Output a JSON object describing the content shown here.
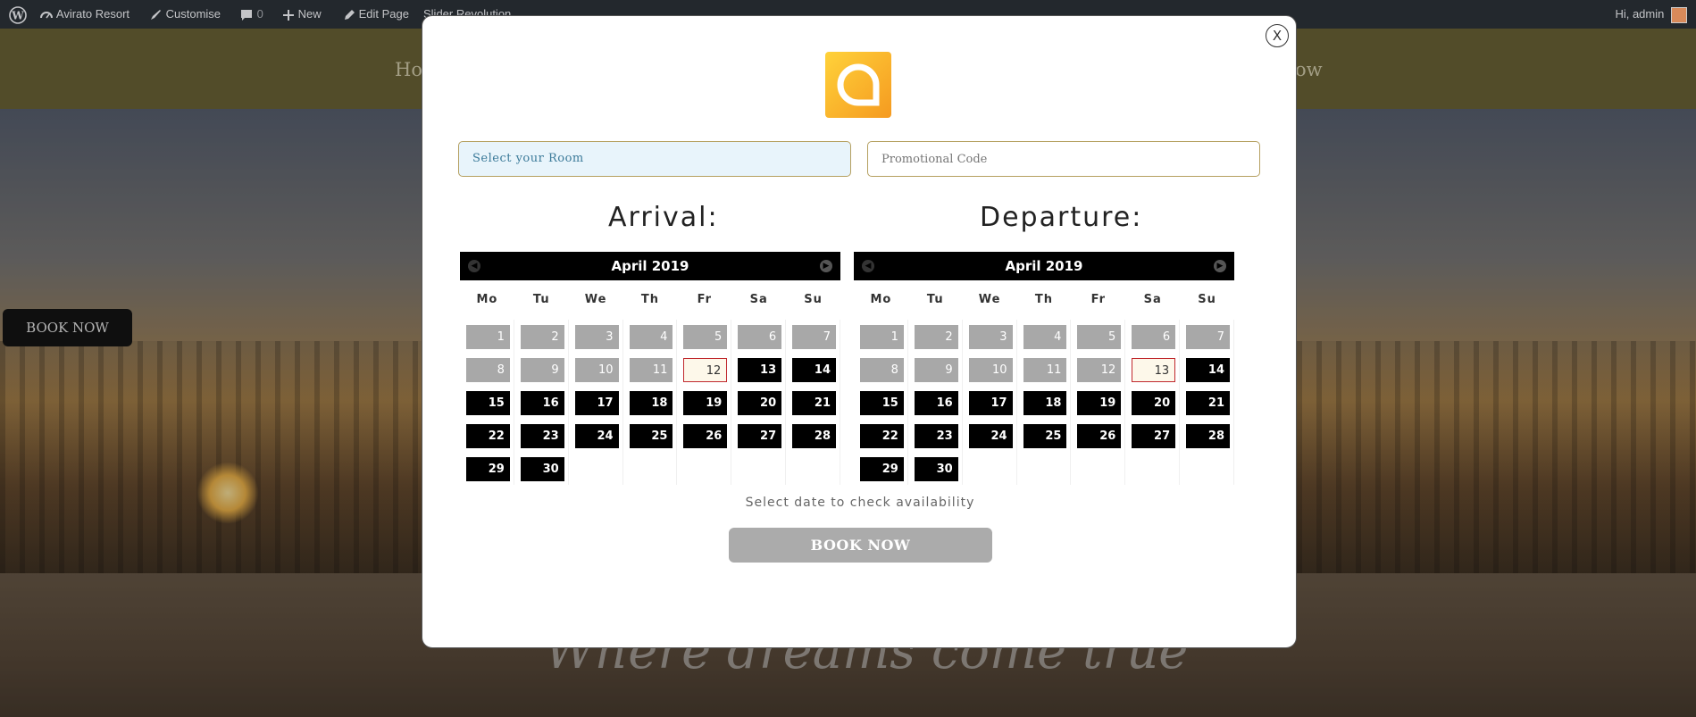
{
  "admin_bar": {
    "site_name": "Avirato Resort",
    "customise": "Customise",
    "comments_count": "0",
    "new": "New",
    "edit_page": "Edit Page",
    "slider": "Slider Revolution",
    "greeting": "Hi, admin"
  },
  "site": {
    "nav_left": "Ho",
    "nav_right": "ow",
    "side_book_label": "BOOK NOW",
    "hero_text": "Where dreams come true"
  },
  "modal": {
    "close_label": "X",
    "room_select": "Select your Room",
    "promo_placeholder": "Promotional Code",
    "arrival_title": "Arrival:",
    "departure_title": "Departure:",
    "hint": "Select date to check availability",
    "book_label": "BOOK NOW"
  },
  "calendars": [
    {
      "month": "April 2019",
      "weekdays": [
        "Mo",
        "Tu",
        "We",
        "Th",
        "Fr",
        "Sa",
        "Su"
      ],
      "last_past_day": 11,
      "selected_day": 12,
      "days_in_month": 30,
      "first_weekday_index": 0
    },
    {
      "month": "April 2019",
      "weekdays": [
        "Mo",
        "Tu",
        "We",
        "Th",
        "Fr",
        "Sa",
        "Su"
      ],
      "last_past_day": 12,
      "selected_day": 13,
      "days_in_month": 30,
      "first_weekday_index": 0
    }
  ],
  "colors": {
    "accent_gold": "#b5a060",
    "selected_border": "#c0282d",
    "past_day": "#a8a8a8",
    "available_day": "#000000"
  }
}
